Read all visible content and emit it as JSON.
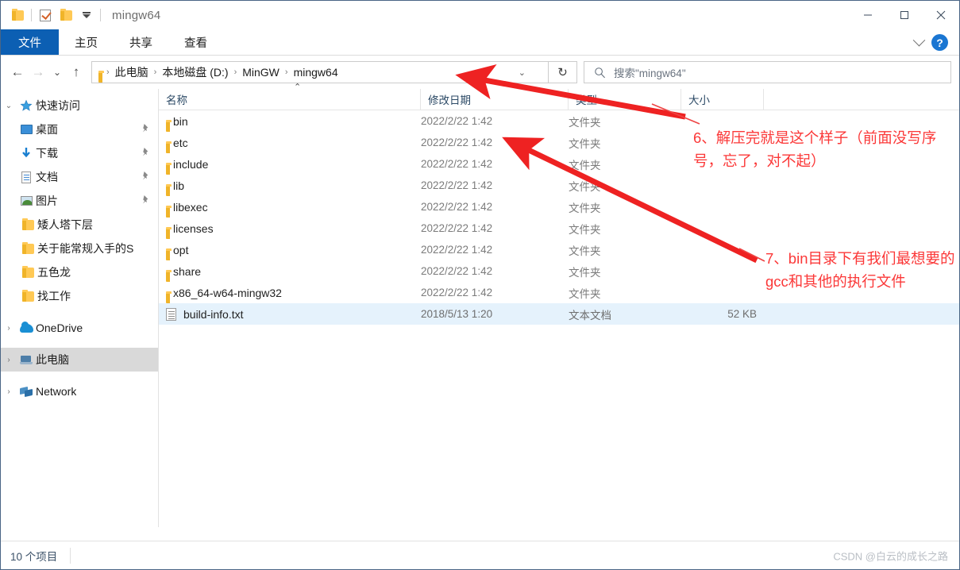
{
  "titlebar": {
    "title": "mingw64",
    "qat": [
      {
        "name": "folder-icon",
        "label": ""
      },
      {
        "name": "properties-icon",
        "label": ""
      },
      {
        "name": "new-folder-icon",
        "label": ""
      },
      {
        "name": "customize-quick-access-caret",
        "label": ""
      }
    ],
    "minimize": "–",
    "maximize": "□",
    "close": "✕"
  },
  "ribbon": {
    "tabs": [
      {
        "id": "file",
        "label": "文件"
      },
      {
        "id": "home",
        "label": "主页"
      },
      {
        "id": "share",
        "label": "共享"
      },
      {
        "id": "view",
        "label": "查看"
      }
    ],
    "collapse_icon": "chevron-down-icon",
    "help_label": "?"
  },
  "nav": {
    "back": "←",
    "forward": "→",
    "recent": "⌄",
    "up": "↑"
  },
  "address": {
    "crumbs": [
      "此电脑",
      "本地磁盘 (D:)",
      "MinGW",
      "mingw64"
    ],
    "separator": "›",
    "dropdown": "⌄",
    "refresh": "↻"
  },
  "search": {
    "icon": "search-icon",
    "placeholder": "搜索\"mingw64\""
  },
  "sidebar": {
    "items": [
      {
        "label": "快速访问",
        "icon": "star-icon",
        "indent": 0,
        "expander": "⌄",
        "pinned": false,
        "selected": false
      },
      {
        "label": "桌面",
        "icon": "desktop-icon",
        "indent": 1,
        "expander": "",
        "pinned": true,
        "selected": false
      },
      {
        "label": "下载",
        "icon": "download-icon",
        "indent": 1,
        "expander": "",
        "pinned": true,
        "selected": false
      },
      {
        "label": "文档",
        "icon": "documents-icon",
        "indent": 1,
        "expander": "",
        "pinned": true,
        "selected": false
      },
      {
        "label": "图片",
        "icon": "pictures-icon",
        "indent": 1,
        "expander": "",
        "pinned": true,
        "selected": false
      },
      {
        "label": "矮人塔下层",
        "icon": "folder-icon",
        "indent": 1,
        "expander": "",
        "pinned": false,
        "selected": false
      },
      {
        "label": "关于能常规入手的S",
        "icon": "folder-icon",
        "indent": 1,
        "expander": "",
        "pinned": false,
        "selected": false
      },
      {
        "label": "五色龙",
        "icon": "folder-icon",
        "indent": 1,
        "expander": "",
        "pinned": false,
        "selected": false
      },
      {
        "label": "找工作",
        "icon": "folder-icon",
        "indent": 1,
        "expander": "",
        "pinned": false,
        "selected": false
      },
      {
        "label": "OneDrive",
        "icon": "onedrive-icon",
        "indent": 0,
        "expander": "›",
        "pinned": false,
        "selected": false
      },
      {
        "label": "此电脑",
        "icon": "this-pc-icon",
        "indent": 0,
        "expander": "›",
        "pinned": false,
        "selected": true
      },
      {
        "label": "Network",
        "icon": "network-icon",
        "indent": 0,
        "expander": "›",
        "pinned": false,
        "selected": false
      }
    ],
    "pin_glyph": "📌"
  },
  "filelist": {
    "columns": [
      {
        "key": "name",
        "label": "名称"
      },
      {
        "key": "date",
        "label": "修改日期"
      },
      {
        "key": "type",
        "label": "类型"
      },
      {
        "key": "size",
        "label": "大小"
      }
    ],
    "sort_indicator": "⌃",
    "rows": [
      {
        "name": "bin",
        "date": "2022/2/22 1:42",
        "type": "文件夹",
        "size": "",
        "icon": "folder-icon",
        "selected": false
      },
      {
        "name": "etc",
        "date": "2022/2/22 1:42",
        "type": "文件夹",
        "size": "",
        "icon": "folder-icon",
        "selected": false
      },
      {
        "name": "include",
        "date": "2022/2/22 1:42",
        "type": "文件夹",
        "size": "",
        "icon": "folder-icon",
        "selected": false
      },
      {
        "name": "lib",
        "date": "2022/2/22 1:42",
        "type": "文件夹",
        "size": "",
        "icon": "folder-icon",
        "selected": false
      },
      {
        "name": "libexec",
        "date": "2022/2/22 1:42",
        "type": "文件夹",
        "size": "",
        "icon": "folder-icon",
        "selected": false
      },
      {
        "name": "licenses",
        "date": "2022/2/22 1:42",
        "type": "文件夹",
        "size": "",
        "icon": "folder-icon",
        "selected": false
      },
      {
        "name": "opt",
        "date": "2022/2/22 1:42",
        "type": "文件夹",
        "size": "",
        "icon": "folder-icon",
        "selected": false
      },
      {
        "name": "share",
        "date": "2022/2/22 1:42",
        "type": "文件夹",
        "size": "",
        "icon": "folder-icon",
        "selected": false
      },
      {
        "name": "x86_64-w64-mingw32",
        "date": "2022/2/22 1:42",
        "type": "文件夹",
        "size": "",
        "icon": "folder-icon",
        "selected": false
      },
      {
        "name": "build-info.txt",
        "date": "2018/5/13 1:20",
        "type": "文本文档",
        "size": "52 KB",
        "icon": "text-file-icon",
        "selected": true
      }
    ]
  },
  "annotations": [
    {
      "id": "anno1",
      "text": "6、解压完就是这个样子（前面没写序号，忘了，对不起）",
      "color": "#fb3838"
    },
    {
      "id": "anno2",
      "text": "7、bin目录下有我们最想要的gcc和其他的执行文件",
      "color": "#fb3838"
    }
  ],
  "statusbar": {
    "count": "10 个项目",
    "watermark": "CSDN @白云的成长之路"
  }
}
